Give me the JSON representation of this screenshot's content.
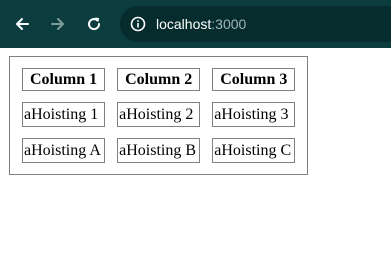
{
  "browser": {
    "url_host": "localhost",
    "url_port": ":3000",
    "toolbar_color": "#0b3d3f",
    "omnibox_color": "#062c2e",
    "icons": {
      "back": "arrow-left-icon",
      "forward": "arrow-right-icon",
      "reload": "reload-icon",
      "site_info": "info-icon"
    }
  },
  "table": {
    "headers": [
      "Column 1",
      "Column 2",
      "Column 3"
    ],
    "rows": [
      [
        "aHoisting 1",
        "aHoisting 2",
        "aHoisting 3"
      ],
      [
        "aHoisting A",
        "aHoisting B",
        "aHoisting C"
      ]
    ]
  }
}
